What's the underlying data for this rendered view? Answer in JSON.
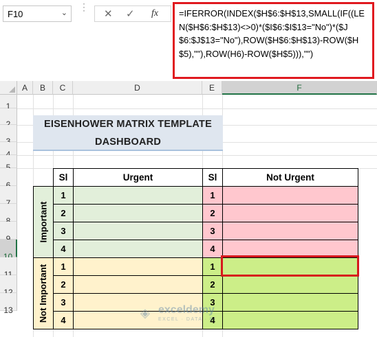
{
  "name_box": {
    "value": "F10"
  },
  "formula_bar": {
    "cancel_glyph": "✕",
    "confirm_glyph": "✓",
    "fx_label": "fx",
    "formula": "=IFERROR(INDEX($H$6:$H$13,SMALL(IF((LEN($H$6:$H$13)<>0)*($I$6:$I$13=\"No\")*($J$6:$J$13=\"No\"),ROW($H$6:$H$13)-ROW($H$5),\"\"),ROW(H6)-ROW($H$5))),\"\")"
  },
  "columns": [
    "A",
    "B",
    "C",
    "D",
    "E",
    "F"
  ],
  "selected_column": "F",
  "rows": [
    "1",
    "2",
    "3",
    "4",
    "5",
    "6",
    "7",
    "8",
    "9",
    "10",
    "11",
    "12",
    "13"
  ],
  "selected_row": "10",
  "title": {
    "line1": "EISENHOWER MATRIX TEMPLATE",
    "line2": "DASHBOARD"
  },
  "table": {
    "sl_header": "Sl",
    "urgent_header": "Urgent",
    "not_urgent_header": "Not Urgent",
    "groups": [
      {
        "label": "Important",
        "serials": [
          "1",
          "2",
          "3",
          "4"
        ]
      },
      {
        "label": "Not Important",
        "serials": [
          "1",
          "2",
          "3",
          "4"
        ]
      }
    ]
  },
  "colors": {
    "important_urgent": "#e2efda",
    "important_not_urgent": "#ffc7ce",
    "not_important_urgent": "#fff2cc",
    "not_important_not_urgent": "#ccee88",
    "highlight": "#d6191d",
    "title_band": "#dfe6ef"
  },
  "watermark": {
    "name": "exceldemy",
    "tagline": "EXCEL · DATA · BI",
    "icon": "exceldemy-logo-icon"
  }
}
